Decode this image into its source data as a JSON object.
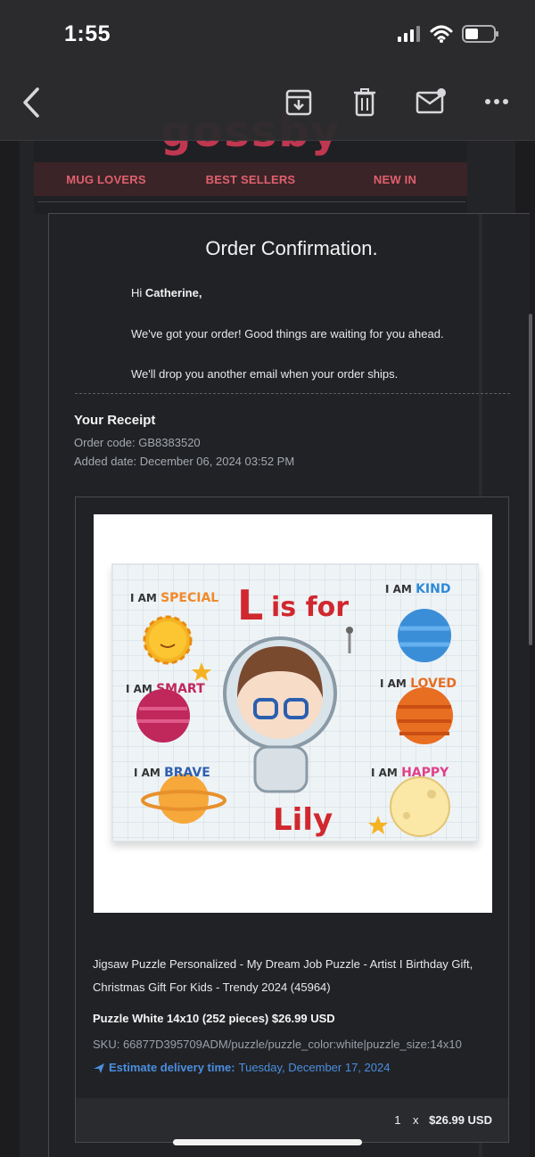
{
  "status_bar": {
    "time": "1:55"
  },
  "toolbar": {
    "back": "chevron-left-icon",
    "archive": "archive-icon",
    "delete": "trash-icon",
    "mark": "envelope-badge-icon",
    "more": "ellipsis-icon"
  },
  "email": {
    "nav": [
      "MUG LOVERS",
      "BEST SELLERS",
      "NEW IN"
    ],
    "title": "Order Confirmation.",
    "greeting_prefix": "Hi ",
    "greeting_name": "Catherine,",
    "para1": "We've got your order! Good things are waiting for you ahead.",
    "para2": "We'll drop you another email when your order ships.",
    "receipt_heading": "Your Receipt",
    "order_code": "Order code: GB8383520",
    "added_date": "Added date: December 06, 2024 03:52 PM",
    "item": {
      "image_texts": {
        "headline": "L is for",
        "name": "Lily",
        "tags": [
          "I AM SPECIAL",
          "I AM KIND",
          "I AM SMART",
          "I AM LOVED",
          "I AM BRAVE",
          "I AM HAPPY"
        ]
      },
      "name_line1": "Jigsaw Puzzle Personalized - My Dream Job Puzzle - Artist I Birthday Gift,",
      "name_line2": "Christmas Gift For Kids - Trendy 2024 (45964)",
      "variant": "Puzzle White 14x10 (252 pieces) $26.99 USD",
      "sku": "SKU: 66877D395709ADM/puzzle/puzzle_color:white|puzzle_size:14x10",
      "eta_label": "Estimate delivery time:",
      "eta_value": "Tuesday, December 17, 2024",
      "qty": "1",
      "times": "x",
      "line_total": "$26.99 USD"
    }
  },
  "colors": {
    "accent": "#e0606d",
    "link": "#4a8fe0",
    "bg": "#1c1c1e"
  }
}
